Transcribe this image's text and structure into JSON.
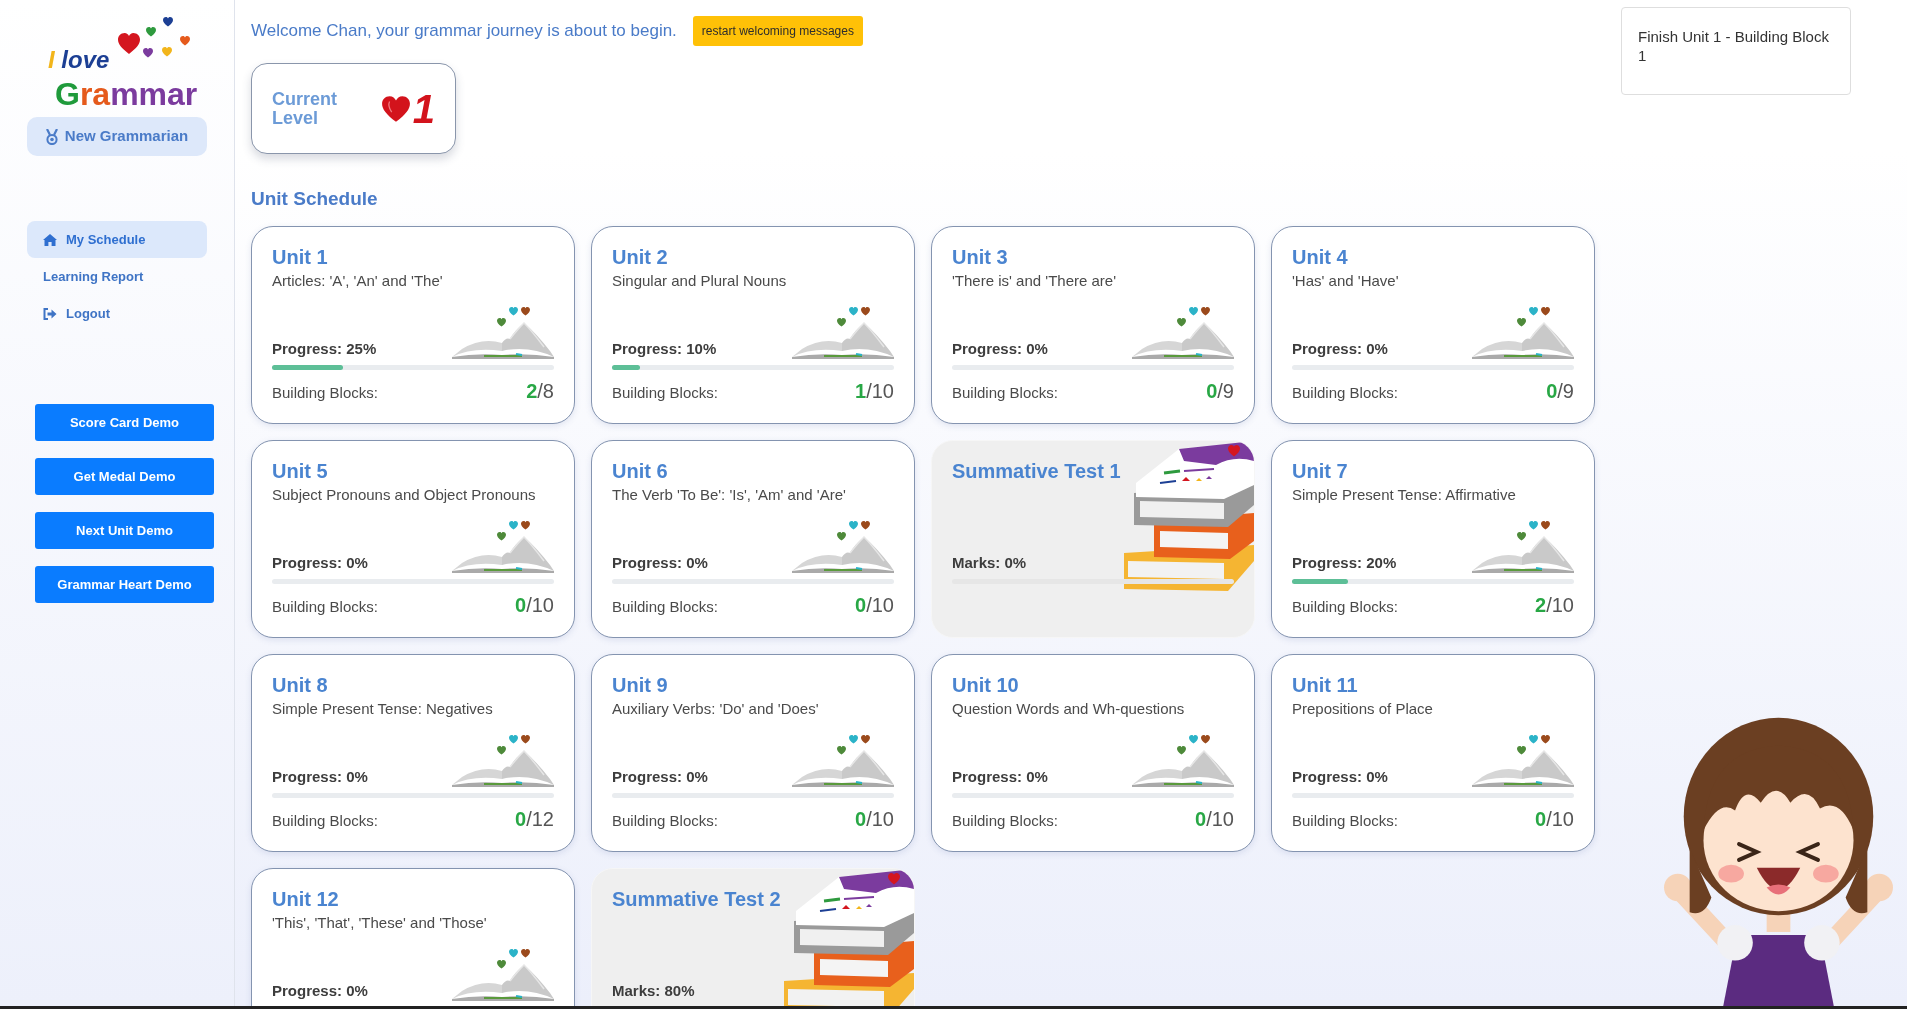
{
  "sidebar": {
    "logo": {
      "line_1": "I love",
      "line_2": "Grammar"
    },
    "rank_badge": {
      "label": "New Grammarian"
    },
    "nav_items": [
      {
        "kind": "home",
        "label": "My Schedule",
        "selected": true
      },
      {
        "kind": "plain",
        "label": "Learning Report",
        "selected": false
      },
      {
        "kind": "logout",
        "label": "Logout",
        "selected": false
      }
    ],
    "demo_buttons": [
      "Score Card Demo",
      "Get Medal Demo",
      "Next Unit Demo",
      "Grammar Heart Demo"
    ]
  },
  "header": {
    "welcome": "Welcome Chan, your grammar journey is about to begin.",
    "restart_button": "restart welcoming messages"
  },
  "current_level": {
    "label": "Current Level",
    "value": "1"
  },
  "next_task": {
    "text": "Finish Unit 1 - Building Block 1"
  },
  "unit_schedule": {
    "title": "Unit Schedule",
    "cards": [
      {
        "kind": "unit",
        "title": "Unit 1",
        "subtitle": "Articles: 'A', 'An' and 'The'",
        "progress_label": "Progress: 25%",
        "level": 0.25,
        "blocks_label": "Building Blocks:",
        "blocks_done": "2",
        "blocks_total": "/8"
      },
      {
        "kind": "unit",
        "title": "Unit 2",
        "subtitle": "Singular and Plural Nouns",
        "progress_label": "Progress: 10%",
        "level": 0.1,
        "blocks_label": "Building Blocks:",
        "blocks_done": "1",
        "blocks_total": "/10"
      },
      {
        "kind": "unit",
        "title": "Unit 3",
        "subtitle": "'There is' and 'There are'",
        "progress_label": "Progress: 0%",
        "blocks_label": "Building Blocks:",
        "blocks_done": "0",
        "blocks_total": "/9"
      },
      {
        "kind": "unit",
        "title": "Unit 4",
        "subtitle": "'Has' and 'Have'",
        "progress_label": "Progress: 0%",
        "blocks_label": "Building Blocks:",
        "blocks_done": "0",
        "blocks_total": "/9"
      },
      {
        "kind": "unit",
        "title": "Unit 5",
        "subtitle": "Subject Pronouns and Object Pronouns",
        "progress_label": "Progress: 0%",
        "blocks_label": "Building Blocks:",
        "blocks_done": "0",
        "blocks_total": "/10"
      },
      {
        "kind": "unit",
        "title": "Unit 6",
        "subtitle": "The Verb 'To Be': 'Is', 'Am' and 'Are'",
        "progress_label": "Progress: 0%",
        "blocks_label": "Building Blocks:",
        "blocks_done": "0",
        "blocks_total": "/10"
      },
      {
        "kind": "test",
        "title": "Summative Test 1",
        "progress_label": "Marks: 0%"
      },
      {
        "kind": "unit",
        "title": "Unit 7",
        "subtitle": "Simple Present Tense: Affirmative",
        "progress_label": "Progress: 20%",
        "level": 0.2,
        "blocks_label": "Building Blocks:",
        "blocks_done": "2",
        "blocks_total": "/10"
      },
      {
        "kind": "unit",
        "title": "Unit 8",
        "subtitle": "Simple Present Tense: Negatives",
        "progress_label": "Progress: 0%",
        "blocks_label": "Building Blocks:",
        "blocks_done": "0",
        "blocks_total": "/12"
      },
      {
        "kind": "unit",
        "title": "Unit 9",
        "subtitle": "Auxiliary Verbs: 'Do' and 'Does'",
        "progress_label": "Progress: 0%",
        "blocks_label": "Building Blocks:",
        "blocks_done": "0",
        "blocks_total": "/10"
      },
      {
        "kind": "unit",
        "title": "Unit 10",
        "subtitle": "Question Words and Wh-questions",
        "progress_label": "Progress: 0%",
        "blocks_label": "Building Blocks:",
        "blocks_done": "0",
        "blocks_total": "/10"
      },
      {
        "kind": "unit",
        "title": "Unit 11",
        "subtitle": "Prepositions of Place",
        "progress_label": "Progress: 0%",
        "blocks_label": "Building Blocks:",
        "blocks_done": "0",
        "blocks_total": "/10"
      },
      {
        "kind": "unit",
        "title": "Unit 12",
        "subtitle": "'This', 'That', 'These' and 'Those'",
        "progress_label": "Progress: 0%"
      },
      {
        "kind": "test",
        "title": "Summative Test 2",
        "progress_label": "Marks: 80%"
      }
    ]
  }
}
